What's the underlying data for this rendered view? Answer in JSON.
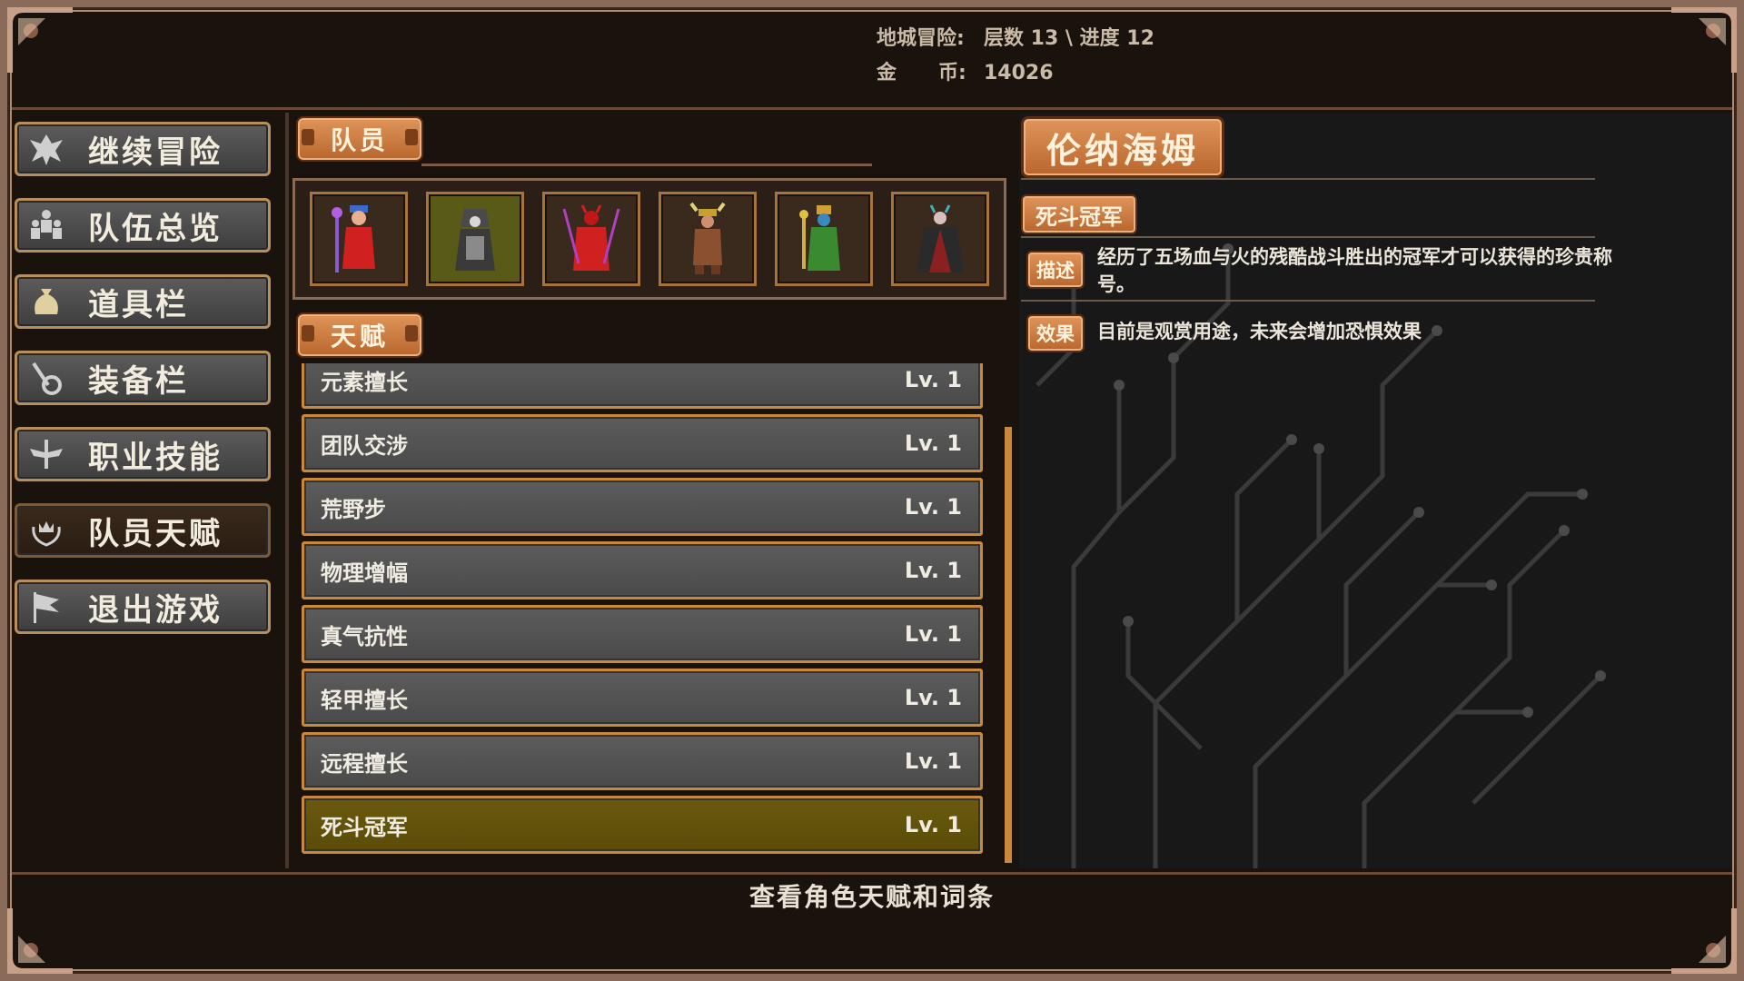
{
  "header": {
    "dungeon_label": "地城冒险:",
    "dungeon_value": "层数 13 \\ 进度 12",
    "gold_label": "金      币:",
    "gold_value": "14026"
  },
  "sidebar": {
    "items": [
      {
        "label": "继续冒险",
        "icon": "dragon-icon",
        "active": false
      },
      {
        "label": "队伍总览",
        "icon": "party-icon",
        "active": false
      },
      {
        "label": "道具栏",
        "icon": "bag-icon",
        "active": false
      },
      {
        "label": "装备栏",
        "icon": "equipment-icon",
        "active": false
      },
      {
        "label": "职业技能",
        "icon": "winged-sword-icon",
        "active": false
      },
      {
        "label": "队员天赋",
        "icon": "laurel-crown-icon",
        "active": true
      },
      {
        "label": "退出游戏",
        "icon": "flag-icon",
        "active": false
      }
    ]
  },
  "members": {
    "title": "队员",
    "list": [
      {
        "name": "red-mage",
        "icon": "red-mage-portrait",
        "selected": false
      },
      {
        "name": "hooded-necromancer",
        "icon": "necromancer-portrait",
        "selected": true
      },
      {
        "name": "red-demon",
        "icon": "demon-portrait",
        "selected": false
      },
      {
        "name": "horned-barbarian",
        "icon": "barbarian-portrait",
        "selected": false
      },
      {
        "name": "green-priest",
        "icon": "priest-portrait",
        "selected": false
      },
      {
        "name": "dark-knight",
        "icon": "knight-portrait",
        "selected": false
      }
    ]
  },
  "talents": {
    "title": "天赋",
    "items": [
      {
        "name": "元素擅长",
        "level": "Lv. 1"
      },
      {
        "name": "团队交涉",
        "level": "Lv. 1"
      },
      {
        "name": "荒野步",
        "level": "Lv. 1"
      },
      {
        "name": "物理增幅",
        "level": "Lv. 1"
      },
      {
        "name": "真气抗性",
        "level": "Lv. 1"
      },
      {
        "name": "轻甲擅长",
        "level": "Lv. 1"
      },
      {
        "name": "远程擅长",
        "level": "Lv. 1"
      },
      {
        "name": "死斗冠军",
        "level": "Lv. 1",
        "selected": true
      }
    ]
  },
  "detail": {
    "character_name": "伦纳海姆",
    "talent_title": "死斗冠军",
    "desc_label": "描述",
    "desc_line1": "经历了五场血与火的残酷战斗胜出的冠军才可以获得的珍贵称",
    "desc_line2": "号。",
    "effect_label": "效果",
    "effect_text": "目前是观赏用途，未来会增加恐惧效果"
  },
  "footer": {
    "hint": "查看角色天赋和词条"
  },
  "colors": {
    "accent": "#c9883c",
    "tag_orange": "#d9844a",
    "panel_gray": "#555555",
    "selected_olive": "#5a4c08",
    "background": "#1a120c"
  }
}
